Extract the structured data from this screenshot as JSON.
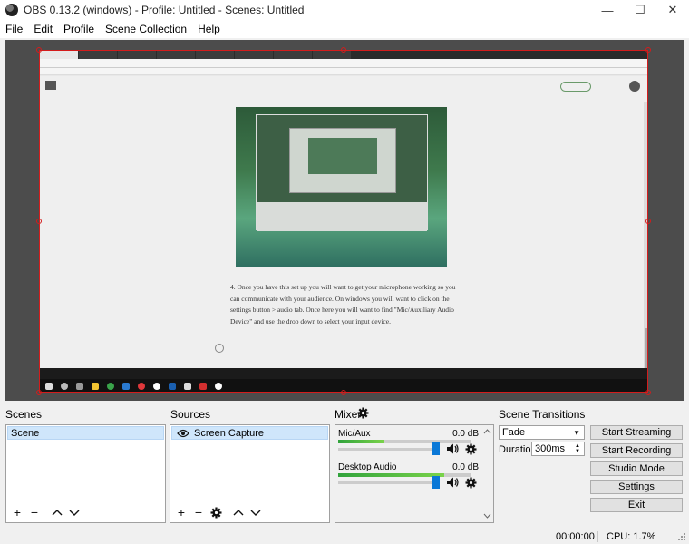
{
  "window": {
    "title": "OBS 0.13.2 (windows) - Profile: Untitled - Scenes: Untitled",
    "minimize": "—",
    "maximize": "☐",
    "close": "✕"
  },
  "menu": [
    "File",
    "Edit",
    "Profile",
    "Scene Collection",
    "Help"
  ],
  "preview": {
    "paragraph": "4. Once you have this set up you will want to get your microphone working so you can communicate with your audience. On windows you will want to click on the settings button > audio tab. Once here you will want to find \"Mic/Auxiliary Audio Device\" and use the drop down to select your input device."
  },
  "scenes": {
    "title": "Scenes",
    "items": [
      "Scene"
    ]
  },
  "sources": {
    "title": "Sources",
    "items": [
      "Screen Capture"
    ]
  },
  "mixer": {
    "title": "Mixer",
    "channels": [
      {
        "name": "Mic/Aux",
        "db": "0.0 dB",
        "meter_level": 0.35,
        "volume": 1.0
      },
      {
        "name": "Desktop Audio",
        "db": "0.0 dB",
        "meter_level": 0.8,
        "volume": 1.0
      }
    ]
  },
  "transitions": {
    "title": "Scene Transitions",
    "selected": "Fade",
    "duration_label": "Duration",
    "duration_value": "300ms"
  },
  "controls": [
    "Start Streaming",
    "Start Recording",
    "Studio Mode",
    "Settings",
    "Exit"
  ],
  "status": {
    "time": "00:00:00",
    "cpu": "CPU: 1.7%"
  },
  "colors": {
    "accent": "#0a78d7",
    "selection_border": "#d41c1c",
    "meter_green": "#31a33c"
  }
}
